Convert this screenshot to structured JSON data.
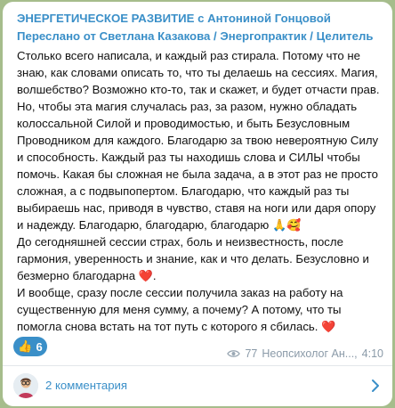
{
  "message": {
    "channel_name": "ЭНЕРГЕТИЧЕСКОЕ РАЗВИТИЕ с Антониной Гонцовой",
    "forwarded_from": "Переслано от Светлана Казакова / Энергопрактик / Целитель",
    "paragraphs": [
      "Столько всего написала, и каждый раз стирала. Потому что не знаю, как словами описать то, что ты делаешь на сессиях. Магия, волшебство? Возможно кто-то, так и скажет, и будет отчасти прав. Но, чтобы эта магия случалась раз, за разом, нужно обладать колоссальной Силой и проводимостью, и быть Безусловным Проводником для каждого. Благодарю за твою невероятную Силу и способность. Каждый раз ты находишь слова и СИЛЫ чтобы помочь. Какая бы сложная не была задача, а в этот раз не просто сложная, а с подвыпопертом. Благодарю, что каждый раз ты выбираешь нас, приводя в чувство, ставя на ноги или даря опору и надежду. Благодарю, благодарю, благодарю",
      "До сегодняшней сессии страх, боль и неизвестность, после гармония, уверенность и знание, как и что делать. Безусловно и безмерно благодарна",
      "И вообще, сразу после сессии получила заказ на работу на существенную для меня сумму, а почему? А потому, что ты помогла снова встать на тот путь с которого я сбилась."
    ],
    "emoji_after_p1": "🙏🥰",
    "emoji_after_p2": "❤️",
    "emoji_after_p3": "❤️"
  },
  "reaction": {
    "icon": "thumbs-up",
    "count": "6"
  },
  "meta": {
    "views": "77",
    "author": "Неопсихолог Ан...,",
    "time": "4:10"
  },
  "comments": {
    "label": "2 комментария"
  },
  "colors": {
    "accent": "#3a8fc8",
    "background": "#a6bd8c",
    "bubble": "#ffffff",
    "meta": "#8a9aa8"
  }
}
